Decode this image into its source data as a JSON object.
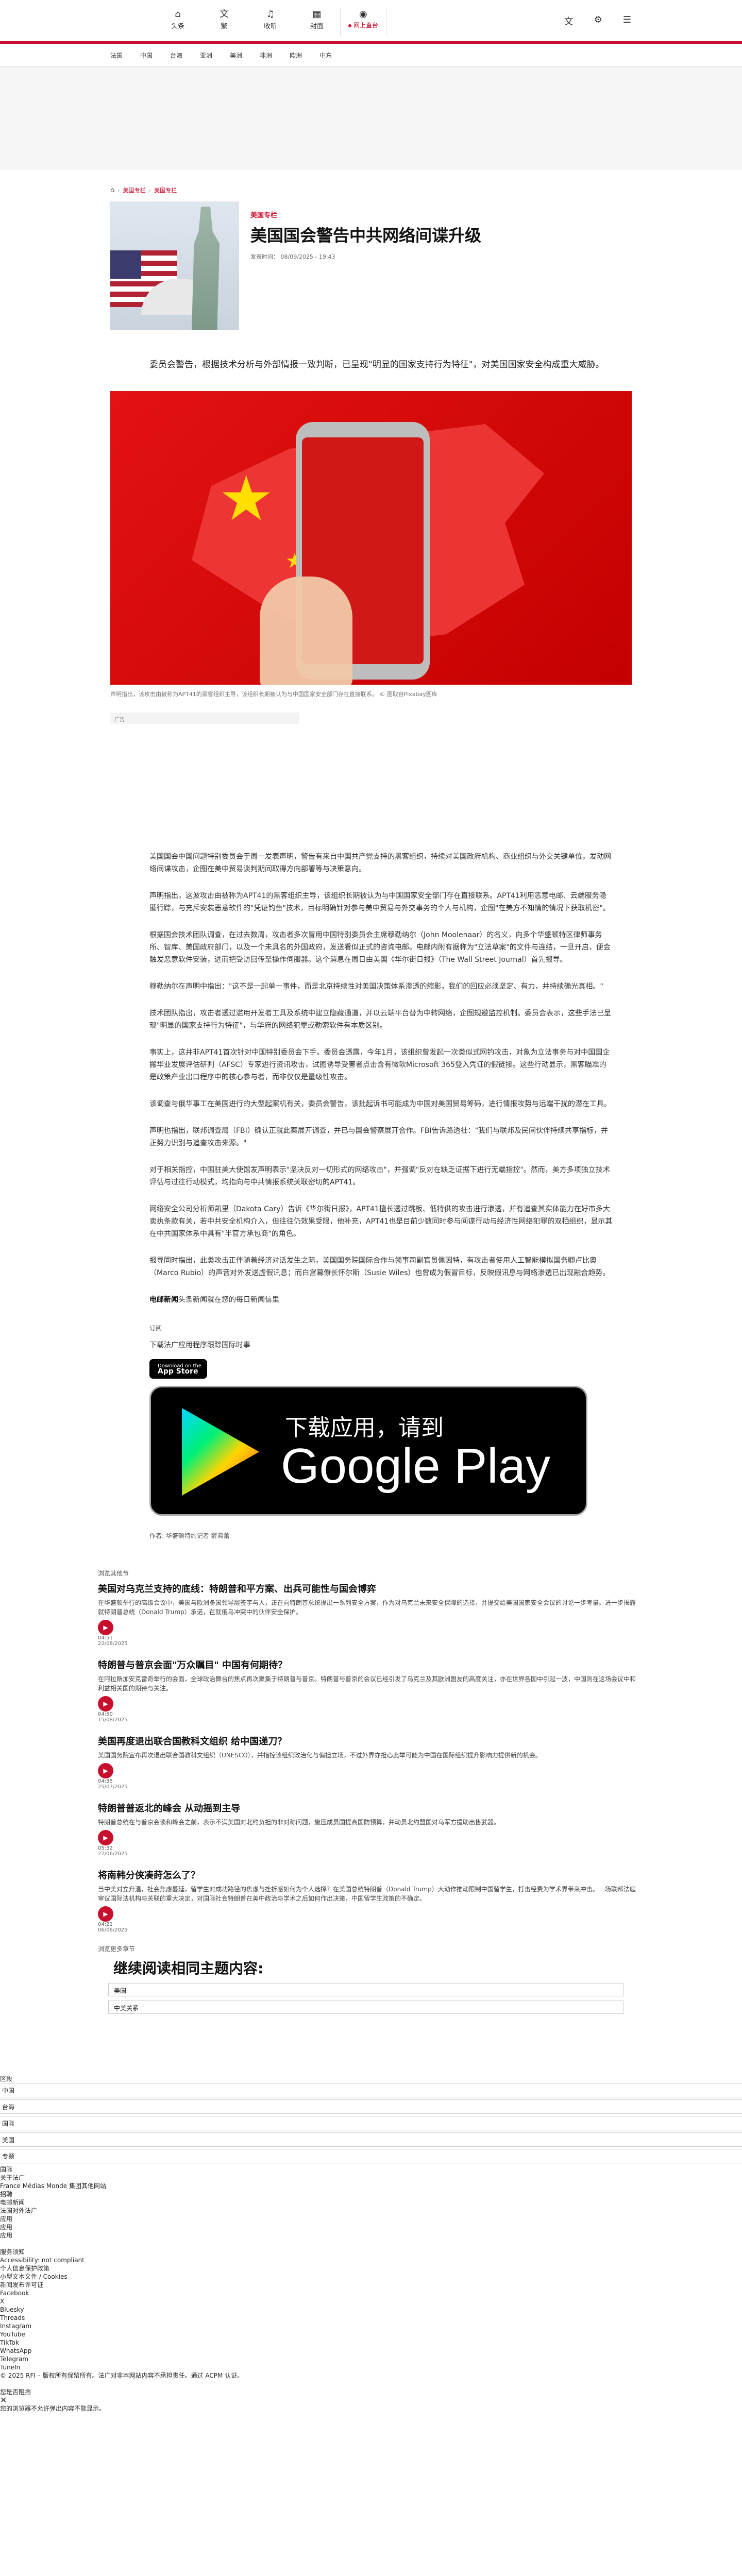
{
  "nav": {
    "items": [
      {
        "label": "头条",
        "icon": "home-icon"
      },
      {
        "label": "繁",
        "icon": "translate-icon"
      },
      {
        "label": "收听",
        "icon": "headphones-icon"
      },
      {
        "label": "封面",
        "icon": "calendar-icon"
      }
    ],
    "live": {
      "label": "网上直台",
      "icon": "radio-icon"
    },
    "tools": [
      "translate-icon",
      "gear-icon",
      "menu-icon"
    ]
  },
  "subnav": [
    "法国",
    "中国",
    "台海",
    "亚洲",
    "美洲",
    "非洲",
    "欧洲",
    "中东"
  ],
  "breadcrumb": {
    "home": "⌂",
    "items": [
      "美国专栏",
      "美国专栏"
    ]
  },
  "article": {
    "tag": "美国专栏",
    "title": "美国国会警告中共网络间谍升级",
    "published": "发表时间： 08/09/2025 - 19:43",
    "lead": "委员会警告，根据技术分析与外部情报一致判断，已呈现\"明显的国家支持行为特征\"，对美国国家安全构成重大威胁。",
    "caption": "声明指出，该攻击由被称为APT41的黑客组织主导，该组织长期被认为与中国国家安全部门存在直接联系。 © 图取自Pixabay图库",
    "ad_label": "广告",
    "paragraphs": [
      "美国国会中国问题特别委员会于周一发表声明，警告有来自中国共产党支持的黑客组织，持续对美国政府机构、商业组织与外交关键单位，发动网络间谍攻击，企图在美中贸易谈判期间取得方向部署等与决策意向。",
      "声明指出，这波攻击由被称为APT41的黑客组织主导，该组织长期被认为与中国国家安全部门存在直接联系。APT41利用恶意电邮、云端服务隐匿行踪，与充斥安装恶意软件的\"凭证钓鱼\"技术，目标明确针对参与美中贸易与外交事务的个人与机构，企图\"在美方不知情的情况下获取机密\"。",
      "根据国会技术团队调查，在过去数周，攻击者多次冒用中国特别委员会主席穆勒纳尔（John Moolenaar）的名义，向多个华盛顿特区律师事务所、智库、美国政府部门，以及一个未具名的外国政府，发送看似正式的咨询电邮。电邮内附有据称为\"立法草案\"的文件与连结，一旦开启，便会触发恶意软件安装，进而把受访回传至操作伺服器。这个消息在周日由美国《华尔街日报》（The Wall Street Journal）首先报导。",
      "穆勒纳尔在声明中指出：\"这不是一起单一事件，而是北京持续性对美国决策体系渗透的缩影，我们的回应必须坚定、有力，并持续确光真相。\"",
      "技术团队指出，攻击者透过滥用开发者工具及系统中建立隐藏通道，并以云端平台替为中转网络，企图规避监控机制。委员会表示，这些手法已呈现\"明显的国家支持行为特征\"，与华府的网络犯罪或勒索软件有本质区别。",
      "事实上，这并非APT41首次针对中国特别委员会下手。委员会透露，今年1月，该组织曾发起一次类似式网钓攻击，对象为立法事务与对中国国企搬华业发展评估研判（AFSC）专家进行资讯攻击，试图诱导受害者点击含有微软Microsoft 365登入凭证的假链接。这些行动显示，黑客瞄准的是政策产业出口程序中的核心参与者，而非仅仅是量级性攻击。",
      "该调查与俄华事工在美国进行的大型起案机有关，委员会警告，该批起诉书可能成为中国对美国贸易筹码，进行情报攻势与远端干扰的潜在工具。",
      "声明也指出，联邦调查局（FBI）确认正就此案展开调查，并已与国会警察展开合作。FBI告诉路透社：\"我们与联邦及民间伙伴持续共享指标，并正努力识别与追查攻击来源。\"",
      "对于相关指控，中国驻美大使馆发声明表示\"坚决反对一切形式的网络攻击\"，并强调\"反对在缺乏证据下进行无端指控\"。然而，美方多项独立技术评估与过往行动模式，均指向与中共情报系统关联密切的APT41。",
      "网络安全公司分析师凯里（Dakota Cary）告诉《华尔街日报》，APT41擅长透过跳板、低特供的攻击进行渗透，并有追查其实体能力在好市多大卖执条款有关，若中共安全机构介入，但往往仍效果受限，他补充，APT41也是目前少数同时参与间谍行动与经济性网络犯罪的双栖组织，显示其在中共国家体系中具有\"半官方承包商\"的角色。",
      "报导同时指出，此类攻击正伴随着经济对话发生之际，美国国务院国际合作与领事司副官员佩因特，有攻击者使用人工智能模拟国务卿卢比奥（Marco Rubio）的声音对外发送虚假讯息；而白宫幕僚长怀尔斯（Susie Wiles）也曾成为假冒目标，反映假讯息与网络渗透已出现融合趋势。"
    ],
    "signoff_name": "电邮新闻",
    "signoff_text": "头条新闻就在您的每日新闻信里",
    "subscribe_label": "订阅",
    "download_line": "下载法广应用程序跟踪国际时事",
    "appstore_top": "Download on the",
    "appstore_bottom": "App Store",
    "gplay_line1": "下载应用，请到",
    "gplay_line2": "Google Play",
    "author": "作者:  华盛顿特约记者 薛弗蕾"
  },
  "related": {
    "header": "浏览其他节",
    "items": [
      {
        "title": "美国对乌克兰支持的底线：特朗普和平方案、出兵可能性与国会博弈",
        "summary": "在华盛顿举行的高级会议中，美国与欧洲多国领导层签字与人，正在向特朗普总统提出一系列安全方案，作为对乌克兰未来安全保障的选择，并提交给美国国家安全会议的讨论一步考量。进一步揭露就特朗普总统（Donald Trump）承诺，在就俄乌冲突中的伙伴安全保护。",
        "duration": "04:51",
        "date": "22/08/2025"
      },
      {
        "title": "特朗普与普京会面\"万众瞩目\" 中国有何期待？",
        "summary": "在阿拉斯加安克雷奇举行的会面，全球政治舞台的焦点再次聚集于特朗普与普京。特朗普与普京的会议已经引发了乌克兰及其欧洲盟友的高度关注，亦在世界各国中引起一波，中国则在这场会议中和利益相关国的期待与关注。",
        "duration": "04:50",
        "date": "15/08/2025"
      },
      {
        "title": "美国再度退出联合国教科文组织 给中国递刀？",
        "summary": "美国国务院宣布再次退出联合国教科文组织（UNESCO），并指控该组织政治化与偏袒立场，不过外界亦担心此举可能为中国在国际组织提升影响力提供新的机会。",
        "duration": "04:35",
        "date": "25/07/2025"
      },
      {
        "title": "特朗普普返北的峰会 从动摇到主导",
        "summary": "特朗普总统在与普京会谈和峰会之前，表示不满美国对北约负担的非对称问题，施压成员国提高国防预算，并动员北约盟国对乌军方援助出售武器。",
        "duration": "05:32",
        "date": "27/06/2025"
      },
      {
        "title": "将南韩分侠凑莳怎么了？",
        "summary": "当中美对立升温，社会焦虑蔓延，留学生对成功路径的焦虑与挫折感如何为个人选择？在美国总统特朗普（Donald Trump）大动作推动限制中国留学生，打击经费为学术界带来冲击。一场联邦法庭审议国际法机构与关联的重大决定，对国际社会特朗普在美中政治与学术之后如何作出决策，中国留学生政策的不确定。",
        "duration": "04:21",
        "date": "06/06/2025"
      }
    ]
  },
  "topics": {
    "header": "浏览更多章节",
    "title": "继续阅读相同主题内容:",
    "items": [
      "美国",
      "中美关系"
    ]
  },
  "footer": {
    "sections_label": "区段",
    "rows": [
      "中国",
      "台海",
      "国际",
      "美国",
      "专题"
    ],
    "links": [
      "国际",
      "关于法广",
      "France Médias Monde 集团其他网站",
      "招聘",
      "电邮新闻",
      "法国对外法广",
      "应用",
      "应用",
      "应用"
    ],
    "legal_header": "服务须知",
    "legal": [
      "Accessibility: not compliant",
      "个人信息保护政策",
      "小型文本文件 / Cookies",
      "新闻发布许可证",
      "Facebook",
      "X",
      "Bluesky",
      "Threads",
      "Instagram",
      "YouTube",
      "TikTok",
      "WhatsApp",
      "Telegram",
      "TuneIn"
    ],
    "copyright": "© 2025 RFI – 版权所有保留所有。法广对非本网站内容不承担责任。通过 ACPM 认证。",
    "close_label": "您是否阻挡",
    "notice": "您的浏览器不允许弹出内容不能显示。"
  }
}
